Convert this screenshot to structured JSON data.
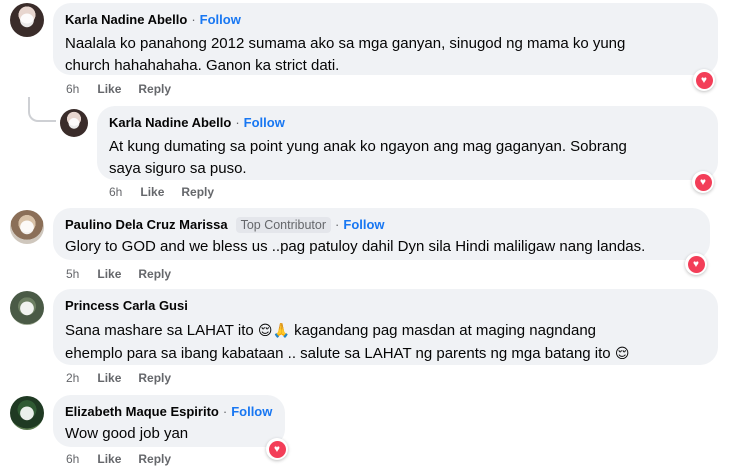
{
  "comments": [
    {
      "author": "Karla Nadine Abello",
      "follow": "Follow",
      "text_lines": [
        "Naalala ko panahong 2012 sumama ako sa mga ganyan, sinugod ng mama ko yung",
        "church hahahahaha. Ganon ka strict dati."
      ],
      "time": "6h",
      "like": "Like",
      "reply": "Reply",
      "reaction": "heart-icon"
    },
    {
      "author": "Karla Nadine Abello",
      "follow": "Follow",
      "text_lines": [
        "At kung dumating sa point yung anak ko ngayon ang mag gaganyan. Sobrang",
        "saya siguro sa puso."
      ],
      "time": "6h",
      "like": "Like",
      "reply": "Reply",
      "reaction": "heart-icon"
    },
    {
      "author": "Paulino Dela Cruz Marissa",
      "badge": "Top Contributor",
      "follow": "Follow",
      "text_lines": [
        "Glory to GOD and we bless us ..pag patuloy dahil Dyn sila Hindi maliligaw nang landas."
      ],
      "time": "5h",
      "like": "Like",
      "reply": "Reply",
      "reaction": "heart-icon"
    },
    {
      "author": "Princess Carla Gusi",
      "text_line_1_a": "Sana mashare sa LAHAT ito",
      "text_line_1_emoji": "😌🙏",
      "text_line_1_b": "kagandang pag masdan at maging nagndang",
      "text_line_2_a": "ehemplo para sa ibang kabataan .. salute sa LAHAT ng parents ng mga batang ito",
      "text_line_2_emoji": "😌",
      "time": "2h",
      "like": "Like",
      "reply": "Reply"
    },
    {
      "author": "Elizabeth Maque Espirito",
      "follow": "Follow",
      "text_lines": [
        "Wow good job yan"
      ],
      "time": "6h",
      "like": "Like",
      "reply": "Reply",
      "reaction": "heart-icon"
    }
  ],
  "colors": {
    "bubble": "#f0f2f5",
    "follow": "#1877f2",
    "meta": "#65676b",
    "heart": "#f33e58"
  }
}
